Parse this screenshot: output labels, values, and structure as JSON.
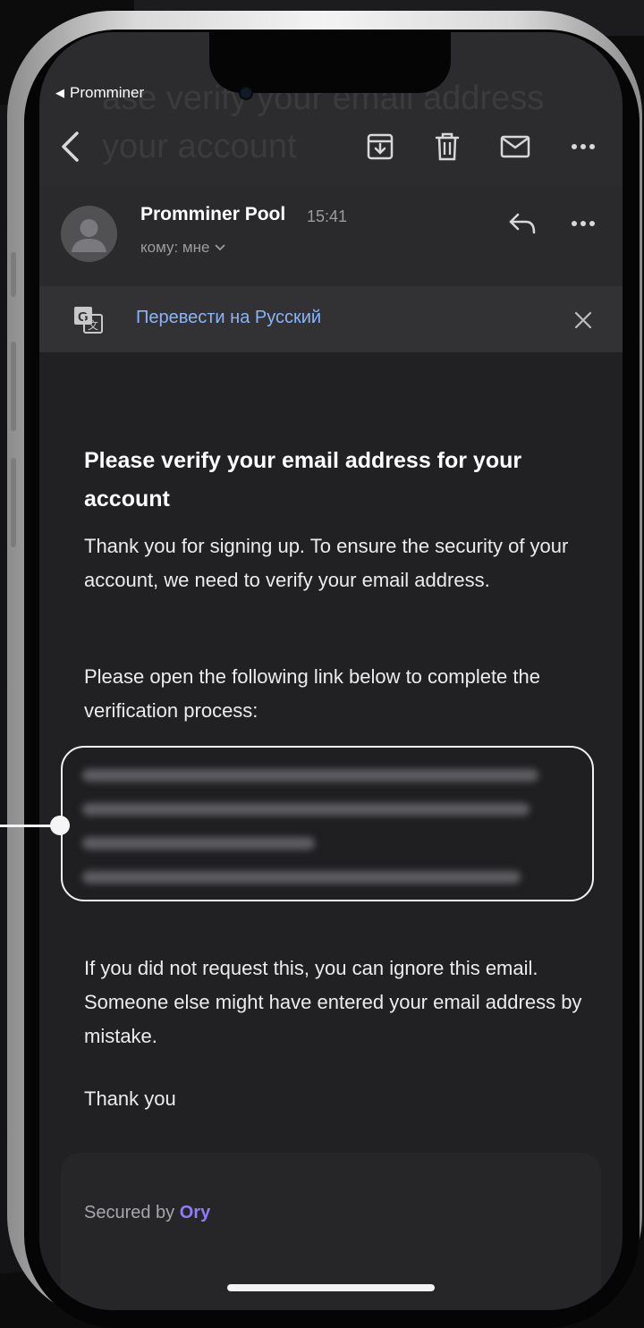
{
  "status_bar": {
    "back_label": "Promminer"
  },
  "toolbar": {
    "ghost_title_line1": "ase verify your email address",
    "ghost_title_line2": "your account",
    "back_icon": "chevron-left-icon",
    "actions": [
      "archive-icon",
      "trash-icon",
      "mail-icon",
      "more-icon"
    ]
  },
  "sender": {
    "name": "Promminer Pool",
    "time": "15:41",
    "recipient": "кому: мне"
  },
  "translate": {
    "label": "Перевести на Русский"
  },
  "email": {
    "heading": "Please verify your email address for your account",
    "para1": "Thank you for signing up. To ensure the security of your account, we need to verify your email address.",
    "para2": "Please open the following link below to complete the verification process:",
    "para3": "If you did not request this, you can ignore this email. Someone else might have entered your email address by mistake.",
    "thanks": "Thank you"
  },
  "footer": {
    "secured_prefix": "Secured by",
    "brand": "Ory"
  },
  "colors": {
    "accent_link": "#8ab4f8",
    "brand_purple": "#8e7cf7",
    "background": "#212123"
  }
}
